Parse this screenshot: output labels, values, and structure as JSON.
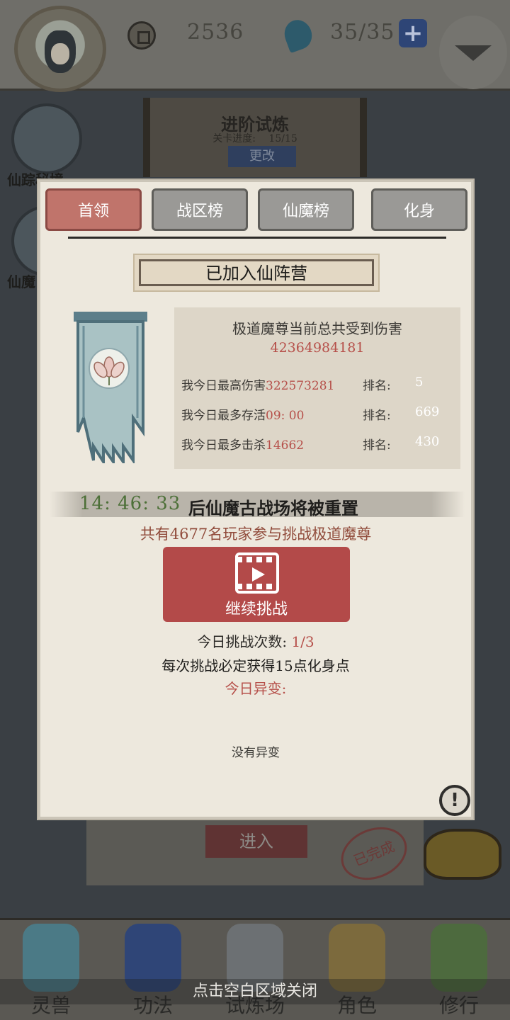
{
  "header": {
    "coins": "2536",
    "energy": "35/35",
    "plus_label": "+"
  },
  "stage_banner": {
    "title": "进阶试炼",
    "progress_label": "关卡进度:",
    "progress_value": "15/15",
    "change_button": "更改"
  },
  "side": {
    "item1_label": "仙踪秘境",
    "item2_label": "仙魔"
  },
  "tabs": [
    {
      "label": "首领"
    },
    {
      "label": "战区榜"
    },
    {
      "label": "仙魔榜"
    },
    {
      "label": "化身"
    }
  ],
  "camp_status": "已加入仙阵营",
  "stats": {
    "title": "极道魔尊当前总共受到伤害",
    "total": "42364984181",
    "rank_label": "排名:",
    "rows": [
      {
        "label": "我今日最高伤害",
        "value": "322573281",
        "rank": "5"
      },
      {
        "label": "我今日最多存活",
        "value": "09: 00",
        "rank": "669"
      },
      {
        "label": "我今日最多击杀",
        "value": "14662",
        "rank": "430"
      }
    ]
  },
  "reset": {
    "time": "14: 46: 33",
    "text": "后仙魔古战场将被重置"
  },
  "players_text": "共有4677名玩家参与挑战极道魔尊",
  "challenge_button": "继续挑战",
  "attempts": {
    "label": "今日挑战次数:",
    "value": "1/3"
  },
  "reward_text": "每次挑战必定获得15点化身点",
  "mutation": {
    "label": "今日异变:",
    "value": "没有异变"
  },
  "info_label": "!",
  "lower": {
    "enter_button": "进入",
    "done_stamp": "已完成"
  },
  "nav": [
    {
      "label": "灵兽"
    },
    {
      "label": "功法"
    },
    {
      "label": "试炼场"
    },
    {
      "label": "角色"
    },
    {
      "label": "修行"
    }
  ],
  "close_hint": "点击空白区域关闭",
  "colors": {
    "accent_red": "#b34a49",
    "value_red": "#b6504a",
    "timer_green": "#4d7038",
    "panel_bg": "#ede8dd"
  }
}
